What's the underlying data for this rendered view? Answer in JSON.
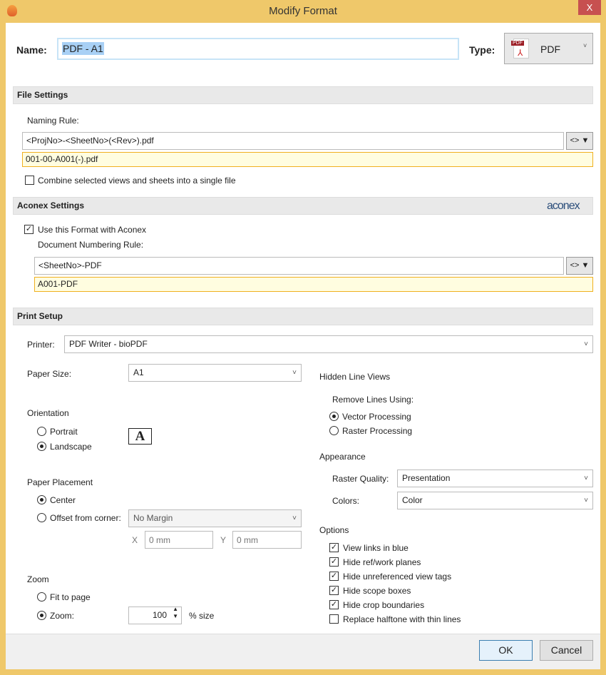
{
  "window": {
    "title": "Modify Format",
    "close": "X"
  },
  "name": {
    "label": "Name:",
    "value": "PDF - A1"
  },
  "type": {
    "label": "Type:",
    "value": "PDF",
    "icon_text": "PDF"
  },
  "file_settings": {
    "header": "File Settings",
    "naming_rule_label": "Naming Rule:",
    "naming_rule": "<ProjNo>-<SheetNo>(<Rev>).pdf",
    "preview": "001-00-A001(-).pdf",
    "combine_label": "Combine selected views and sheets into a single file",
    "combine_checked": false,
    "token_btn": "<> ▼"
  },
  "aconex": {
    "header": "Aconex Settings",
    "logo": "aconex",
    "use_label": "Use this Format with Aconex",
    "use_checked": true,
    "rule_label": "Document Numbering Rule:",
    "rule": "<SheetNo>-PDF",
    "preview": "A001-PDF",
    "token_btn": "<> ▼"
  },
  "print": {
    "header": "Print Setup",
    "printer_label": "Printer:",
    "printer": "PDF Writer - bioPDF",
    "paper_size_label": "Paper Size:",
    "paper_size": "A1",
    "orientation_label": "Orientation",
    "portrait": "Portrait",
    "landscape": "Landscape",
    "orientation_icon": "A",
    "placement_label": "Paper Placement",
    "center": "Center",
    "offset": "Offset from corner:",
    "offset_value": "No Margin",
    "x_label": "X",
    "y_label": "Y",
    "x_placeholder": "0 mm",
    "y_placeholder": "0 mm",
    "zoom_label": "Zoom",
    "fit": "Fit to page",
    "zoom_opt": "Zoom:",
    "zoom_value": "100",
    "zoom_unit": "% size",
    "hidden_label": "Hidden Line Views",
    "remove_label": "Remove Lines Using:",
    "vector": "Vector Processing",
    "raster": "Raster Processing",
    "appearance_label": "Appearance",
    "raster_quality_label": "Raster Quality:",
    "raster_quality": "Presentation",
    "colors_label": "Colors:",
    "colors": "Color",
    "options_label": "Options",
    "options": [
      {
        "label": "View links in blue",
        "checked": true
      },
      {
        "label": "Hide ref/work planes",
        "checked": true
      },
      {
        "label": "Hide unreferenced view tags",
        "checked": true
      },
      {
        "label": "Hide scope boxes",
        "checked": true
      },
      {
        "label": "Hide crop boundaries",
        "checked": true
      },
      {
        "label": "Replace halftone with thin lines",
        "checked": false
      }
    ]
  },
  "buttons": {
    "ok": "OK",
    "cancel": "Cancel"
  }
}
